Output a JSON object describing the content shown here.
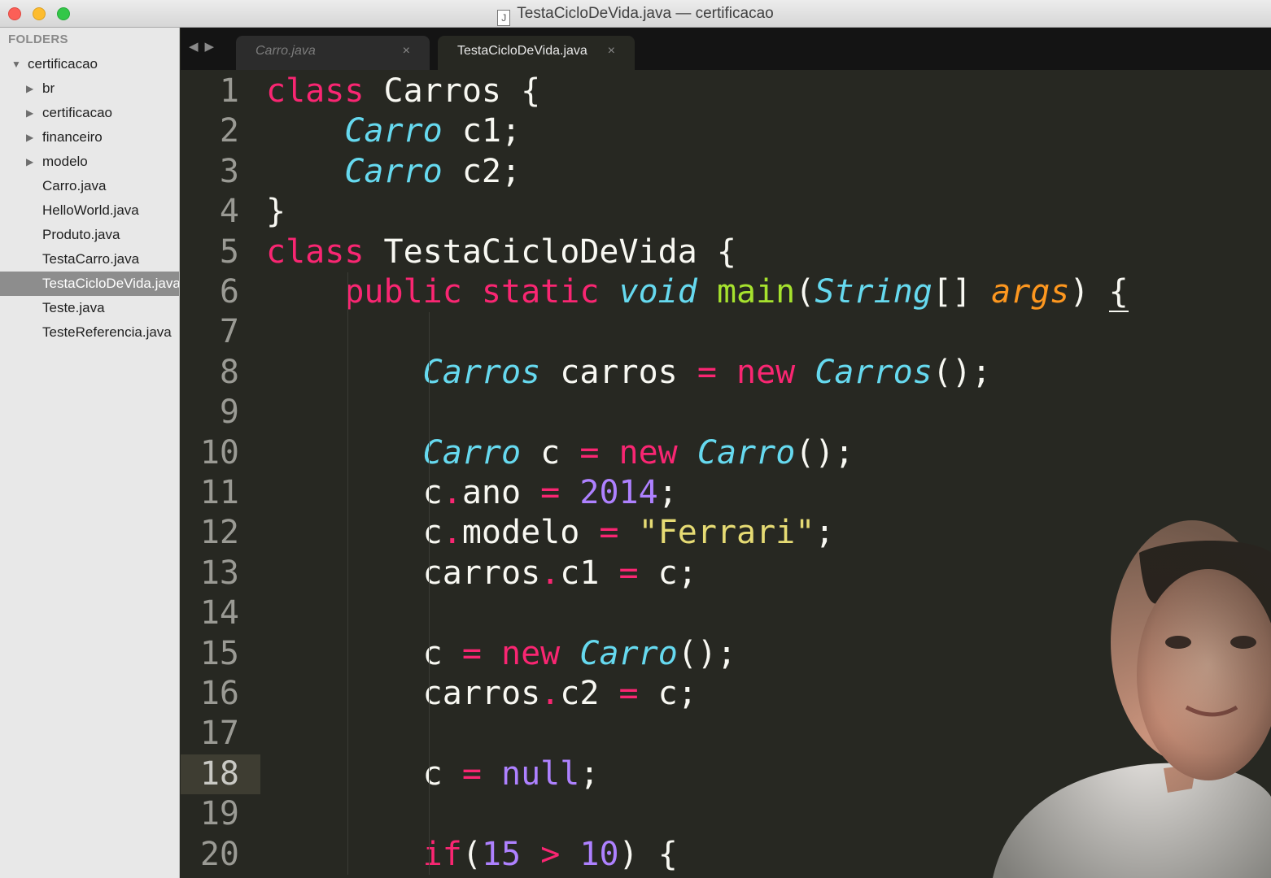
{
  "window": {
    "title": "TestaCicloDeVida.java — certificacao",
    "file_icon_glyph": "J"
  },
  "sidebar": {
    "header": "FOLDERS",
    "items": [
      {
        "label": "certificacao",
        "kind": "folder-open",
        "depth": 0
      },
      {
        "label": "br",
        "kind": "folder",
        "depth": 1
      },
      {
        "label": "certificacao",
        "kind": "folder",
        "depth": 1
      },
      {
        "label": "financeiro",
        "kind": "folder",
        "depth": 1
      },
      {
        "label": "modelo",
        "kind": "folder",
        "depth": 1
      },
      {
        "label": "Carro.java",
        "kind": "file",
        "depth": 1
      },
      {
        "label": "HelloWorld.java",
        "kind": "file",
        "depth": 1
      },
      {
        "label": "Produto.java",
        "kind": "file",
        "depth": 1
      },
      {
        "label": "TestaCarro.java",
        "kind": "file",
        "depth": 1
      },
      {
        "label": "TestaCicloDeVida.java",
        "kind": "file",
        "depth": 1,
        "selected": true
      },
      {
        "label": "Teste.java",
        "kind": "file",
        "depth": 1
      },
      {
        "label": "TesteReferencia.java",
        "kind": "file",
        "depth": 1
      }
    ]
  },
  "tabs": {
    "nav_back": "◀",
    "nav_forward": "▶",
    "items": [
      {
        "label": "Carro.java",
        "close": "×",
        "active": false
      },
      {
        "label": "TestaCicloDeVida.java",
        "close": "×",
        "active": true
      }
    ]
  },
  "editor": {
    "active_line": 18,
    "lines": [
      {
        "n": "1",
        "tokens": [
          [
            "kw",
            "class"
          ],
          [
            "plain",
            " Carros {"
          ]
        ]
      },
      {
        "n": "2",
        "tokens": [
          [
            "plain",
            "    "
          ],
          [
            "type",
            "Carro"
          ],
          [
            "plain",
            " c1;"
          ]
        ]
      },
      {
        "n": "3",
        "tokens": [
          [
            "plain",
            "    "
          ],
          [
            "type",
            "Carro"
          ],
          [
            "plain",
            " c2;"
          ]
        ]
      },
      {
        "n": "4",
        "tokens": [
          [
            "plain",
            "}"
          ]
        ]
      },
      {
        "n": "5",
        "tokens": [
          [
            "kw",
            "class"
          ],
          [
            "plain",
            " TestaCicloDeVida {"
          ]
        ]
      },
      {
        "n": "6",
        "tokens": [
          [
            "plain",
            "    "
          ],
          [
            "kw",
            "public"
          ],
          [
            "plain",
            " "
          ],
          [
            "kw",
            "static"
          ],
          [
            "plain",
            " "
          ],
          [
            "type",
            "void"
          ],
          [
            "plain",
            " "
          ],
          [
            "fn",
            "main"
          ],
          [
            "plain",
            "("
          ],
          [
            "type",
            "String"
          ],
          [
            "plain",
            "[] "
          ],
          [
            "param",
            "args"
          ],
          [
            "plain",
            ") "
          ],
          [
            "brace",
            "{"
          ]
        ]
      },
      {
        "n": "7",
        "tokens": []
      },
      {
        "n": "8",
        "tokens": [
          [
            "plain",
            "        "
          ],
          [
            "type",
            "Carros"
          ],
          [
            "plain",
            " carros "
          ],
          [
            "op",
            "="
          ],
          [
            "plain",
            " "
          ],
          [
            "kw",
            "new"
          ],
          [
            "plain",
            " "
          ],
          [
            "type",
            "Carros"
          ],
          [
            "plain",
            "();"
          ]
        ]
      },
      {
        "n": "9",
        "tokens": []
      },
      {
        "n": "10",
        "tokens": [
          [
            "plain",
            "        "
          ],
          [
            "type",
            "Carro"
          ],
          [
            "plain",
            " c "
          ],
          [
            "op",
            "="
          ],
          [
            "plain",
            " "
          ],
          [
            "kw",
            "new"
          ],
          [
            "plain",
            " "
          ],
          [
            "type",
            "Carro"
          ],
          [
            "plain",
            "();"
          ]
        ]
      },
      {
        "n": "11",
        "tokens": [
          [
            "plain",
            "        c"
          ],
          [
            "op",
            "."
          ],
          [
            "plain",
            "ano "
          ],
          [
            "op",
            "="
          ],
          [
            "plain",
            " "
          ],
          [
            "num",
            "2014"
          ],
          [
            "plain",
            ";"
          ]
        ]
      },
      {
        "n": "12",
        "tokens": [
          [
            "plain",
            "        c"
          ],
          [
            "op",
            "."
          ],
          [
            "plain",
            "modelo "
          ],
          [
            "op",
            "="
          ],
          [
            "plain",
            " "
          ],
          [
            "str",
            "\"Ferrari\""
          ],
          [
            "plain",
            ";"
          ]
        ]
      },
      {
        "n": "13",
        "tokens": [
          [
            "plain",
            "        carros"
          ],
          [
            "op",
            "."
          ],
          [
            "plain",
            "c1 "
          ],
          [
            "op",
            "="
          ],
          [
            "plain",
            " c;"
          ]
        ]
      },
      {
        "n": "14",
        "tokens": []
      },
      {
        "n": "15",
        "tokens": [
          [
            "plain",
            "        c "
          ],
          [
            "op",
            "="
          ],
          [
            "plain",
            " "
          ],
          [
            "kw",
            "new"
          ],
          [
            "plain",
            " "
          ],
          [
            "type",
            "Carro"
          ],
          [
            "plain",
            "();"
          ]
        ]
      },
      {
        "n": "16",
        "tokens": [
          [
            "plain",
            "        carros"
          ],
          [
            "op",
            "."
          ],
          [
            "plain",
            "c2 "
          ],
          [
            "op",
            "="
          ],
          [
            "plain",
            " c;"
          ]
        ]
      },
      {
        "n": "17",
        "tokens": []
      },
      {
        "n": "18",
        "tokens": [
          [
            "plain",
            "        c "
          ],
          [
            "op",
            "="
          ],
          [
            "plain",
            " "
          ],
          [
            "num",
            "null"
          ],
          [
            "plain",
            ";"
          ]
        ]
      },
      {
        "n": "19",
        "tokens": []
      },
      {
        "n": "20",
        "tokens": [
          [
            "plain",
            "        "
          ],
          [
            "kw",
            "if"
          ],
          [
            "plain",
            "("
          ],
          [
            "num",
            "15"
          ],
          [
            "plain",
            " "
          ],
          [
            "op",
            ">"
          ],
          [
            "plain",
            " "
          ],
          [
            "num",
            "10"
          ],
          [
            "plain",
            ") {"
          ]
        ]
      }
    ]
  },
  "colors": {
    "background": "#272822",
    "keyword": "#f92672",
    "type": "#66d9ef",
    "function": "#a6e22e",
    "parameter": "#fd971f",
    "number": "#ae81ff",
    "string": "#e6db74",
    "text": "#f8f8f2",
    "line_number": "#9a9a94",
    "sidebar_bg": "#e8e8e8",
    "sidebar_selected": "#8d8d8d"
  },
  "webcam": {
    "description_icon": "presenter-webcam-overlay"
  }
}
